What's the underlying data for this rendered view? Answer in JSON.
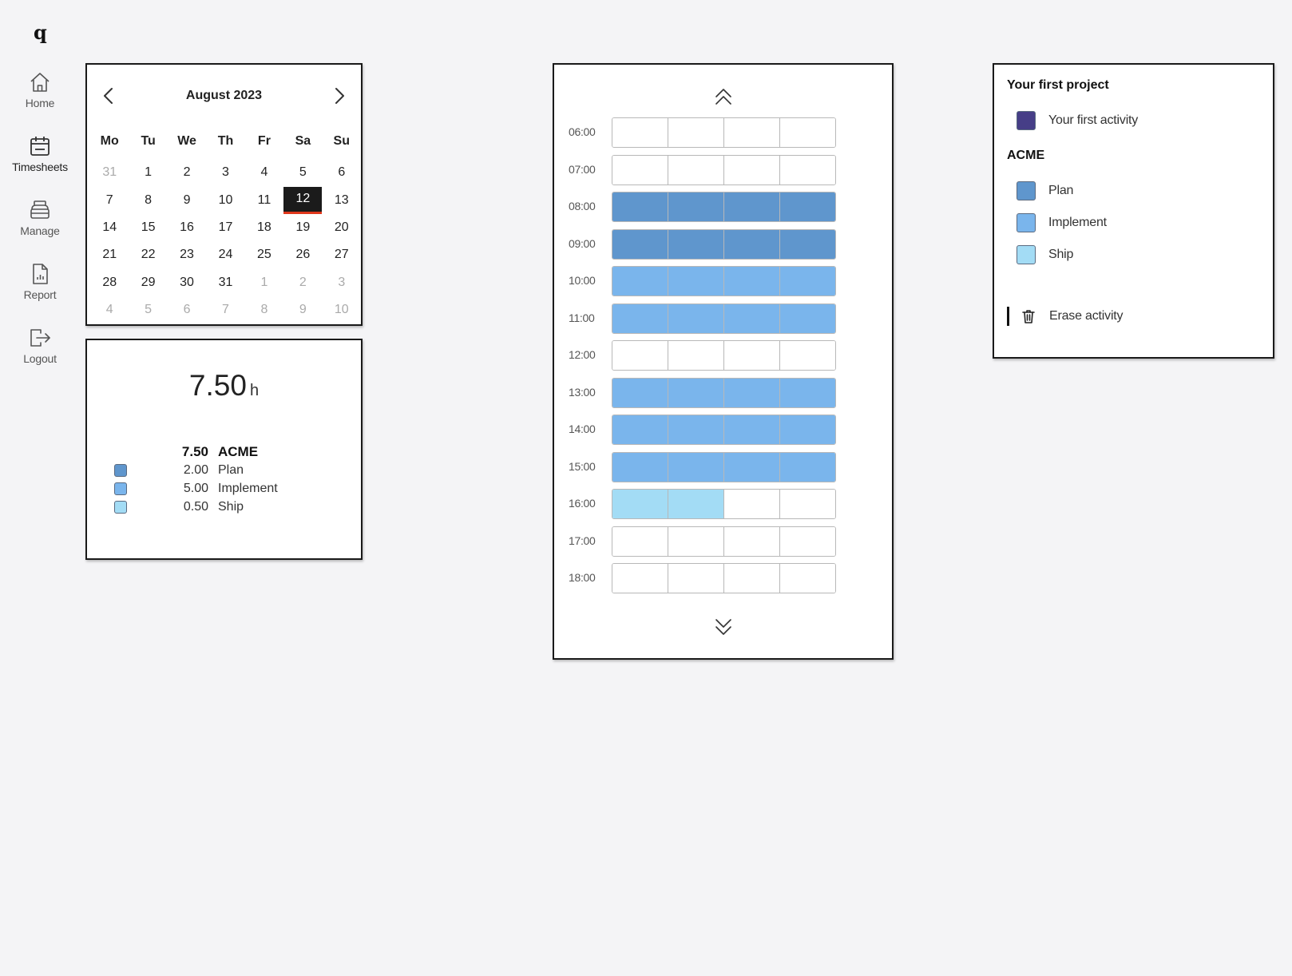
{
  "app": {
    "logo": "q"
  },
  "nav": [
    {
      "label": "Home",
      "icon": "home-icon"
    },
    {
      "label": "Timesheets",
      "icon": "calendar-icon"
    },
    {
      "label": "Manage",
      "icon": "stack-icon"
    },
    {
      "label": "Report",
      "icon": "report-icon"
    },
    {
      "label": "Logout",
      "icon": "logout-icon"
    }
  ],
  "calendar": {
    "title": "August 2023",
    "weekdays": [
      "Mo",
      "Tu",
      "We",
      "Th",
      "Fr",
      "Sa",
      "Su"
    ],
    "selected_day": "12",
    "days": [
      {
        "d": "31",
        "muted": true
      },
      {
        "d": "1"
      },
      {
        "d": "2"
      },
      {
        "d": "3"
      },
      {
        "d": "4"
      },
      {
        "d": "5"
      },
      {
        "d": "6"
      },
      {
        "d": "7"
      },
      {
        "d": "8"
      },
      {
        "d": "9"
      },
      {
        "d": "10"
      },
      {
        "d": "11"
      },
      {
        "d": "12",
        "selected": true
      },
      {
        "d": "13"
      },
      {
        "d": "14"
      },
      {
        "d": "15"
      },
      {
        "d": "16"
      },
      {
        "d": "17"
      },
      {
        "d": "18"
      },
      {
        "d": "19"
      },
      {
        "d": "20"
      },
      {
        "d": "21"
      },
      {
        "d": "22"
      },
      {
        "d": "23"
      },
      {
        "d": "24"
      },
      {
        "d": "25"
      },
      {
        "d": "26"
      },
      {
        "d": "27"
      },
      {
        "d": "28"
      },
      {
        "d": "29"
      },
      {
        "d": "30"
      },
      {
        "d": "31"
      },
      {
        "d": "1",
        "muted": true
      },
      {
        "d": "2",
        "muted": true
      },
      {
        "d": "3",
        "muted": true
      },
      {
        "d": "4",
        "muted": true
      },
      {
        "d": "5",
        "muted": true
      },
      {
        "d": "6",
        "muted": true
      },
      {
        "d": "7",
        "muted": true
      },
      {
        "d": "8",
        "muted": true
      },
      {
        "d": "9",
        "muted": true
      },
      {
        "d": "10",
        "muted": true
      }
    ]
  },
  "summary": {
    "total": "7.50",
    "unit": "h",
    "project": {
      "hours": "7.50",
      "name": "ACME"
    },
    "rows": [
      {
        "hours": "2.00",
        "name": "Plan",
        "color": "#5f96cd"
      },
      {
        "hours": "5.00",
        "name": "Implement",
        "color": "#7ab5ec"
      },
      {
        "hours": "0.50",
        "name": "Ship",
        "color": "#a3dcf5"
      }
    ]
  },
  "timesheet": {
    "slots_per_hour": 4,
    "rows": [
      {
        "time": "06:00",
        "cells": [
          "",
          "",
          "",
          ""
        ]
      },
      {
        "time": "07:00",
        "cells": [
          "",
          "",
          "",
          ""
        ]
      },
      {
        "time": "08:00",
        "cells": [
          "plan",
          "plan",
          "plan",
          "plan"
        ]
      },
      {
        "time": "09:00",
        "cells": [
          "plan",
          "plan",
          "plan",
          "plan"
        ]
      },
      {
        "time": "10:00",
        "cells": [
          "implement",
          "implement",
          "implement",
          "implement"
        ]
      },
      {
        "time": "11:00",
        "cells": [
          "implement",
          "implement",
          "implement",
          "implement"
        ]
      },
      {
        "time": "12:00",
        "cells": [
          "",
          "",
          "",
          ""
        ]
      },
      {
        "time": "13:00",
        "cells": [
          "implement",
          "implement",
          "implement",
          "implement"
        ]
      },
      {
        "time": "14:00",
        "cells": [
          "implement",
          "implement",
          "implement",
          "implement"
        ]
      },
      {
        "time": "15:00",
        "cells": [
          "implement",
          "implement",
          "implement",
          "implement"
        ]
      },
      {
        "time": "16:00",
        "cells": [
          "ship",
          "ship",
          "",
          ""
        ]
      },
      {
        "time": "17:00",
        "cells": [
          "",
          "",
          "",
          ""
        ]
      },
      {
        "time": "18:00",
        "cells": [
          "",
          "",
          "",
          ""
        ]
      }
    ]
  },
  "activity_colors": {
    "first": "#463e87",
    "plan": "#5f96cd",
    "implement": "#7ab5ec",
    "ship": "#a3dcf5",
    "empty": "#ffffff"
  },
  "activities": {
    "projects": [
      {
        "name": "Your first project",
        "items": [
          {
            "name": "Your first activity",
            "color_key": "first"
          }
        ]
      },
      {
        "name": "ACME",
        "items": [
          {
            "name": "Plan",
            "color_key": "plan"
          },
          {
            "name": "Implement",
            "color_key": "implement"
          },
          {
            "name": "Ship",
            "color_key": "ship"
          }
        ]
      }
    ],
    "erase_label": "Erase activity"
  }
}
